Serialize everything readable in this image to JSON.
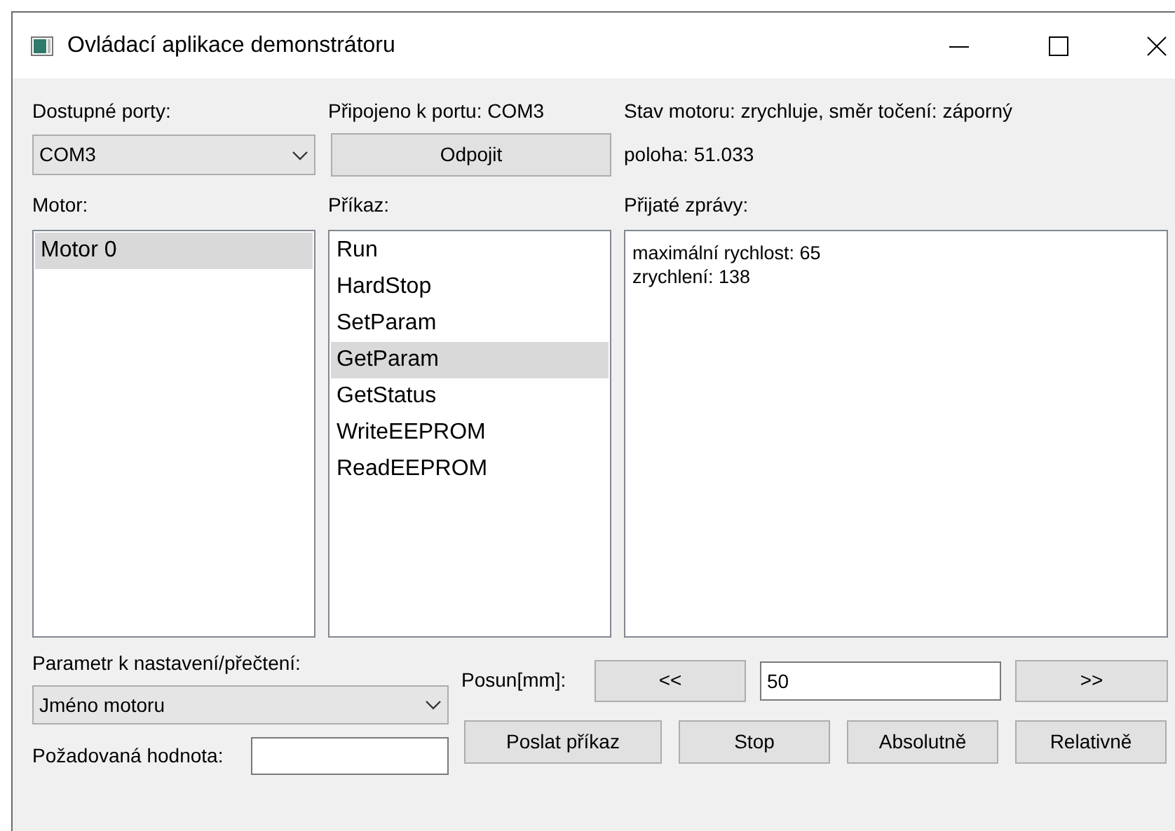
{
  "window": {
    "title": "Ovládací aplikace demonstrátoru"
  },
  "ports": {
    "label": "Dostupné porty:",
    "value": "COM3"
  },
  "connection": {
    "label": "Připojeno k portu: COM3",
    "button": "Odpojit"
  },
  "status": {
    "motor_state": "Stav motoru: zrychluje, směr točení: záporný",
    "position": "poloha: 51.033"
  },
  "motors": {
    "label": "Motor:",
    "items": [
      {
        "label": "Motor 0",
        "selected": true
      }
    ]
  },
  "commands": {
    "label": "Příkaz:",
    "items": [
      {
        "label": "Run",
        "selected": false
      },
      {
        "label": "HardStop",
        "selected": false
      },
      {
        "label": "SetParam",
        "selected": false
      },
      {
        "label": "GetParam",
        "selected": true
      },
      {
        "label": "GetStatus",
        "selected": false
      },
      {
        "label": "WriteEEPROM",
        "selected": false
      },
      {
        "label": "ReadEEPROM",
        "selected": false
      }
    ]
  },
  "messages": {
    "label": "Přijaté zprávy:",
    "lines": [
      "maximální rychlost: 65",
      "zrychlení: 138"
    ]
  },
  "parameter": {
    "label": "Parametr k nastavení/přečtení:",
    "value": "Jméno motoru"
  },
  "desired_value": {
    "label": "Požadovaná hodnota:"
  },
  "shift": {
    "label": "Posun[mm]:",
    "back_button": "<<",
    "value": "50",
    "forward_button": ">>"
  },
  "buttons": [
    "Poslat příkaz",
    "Stop",
    "Absolutně",
    "Relativně"
  ]
}
